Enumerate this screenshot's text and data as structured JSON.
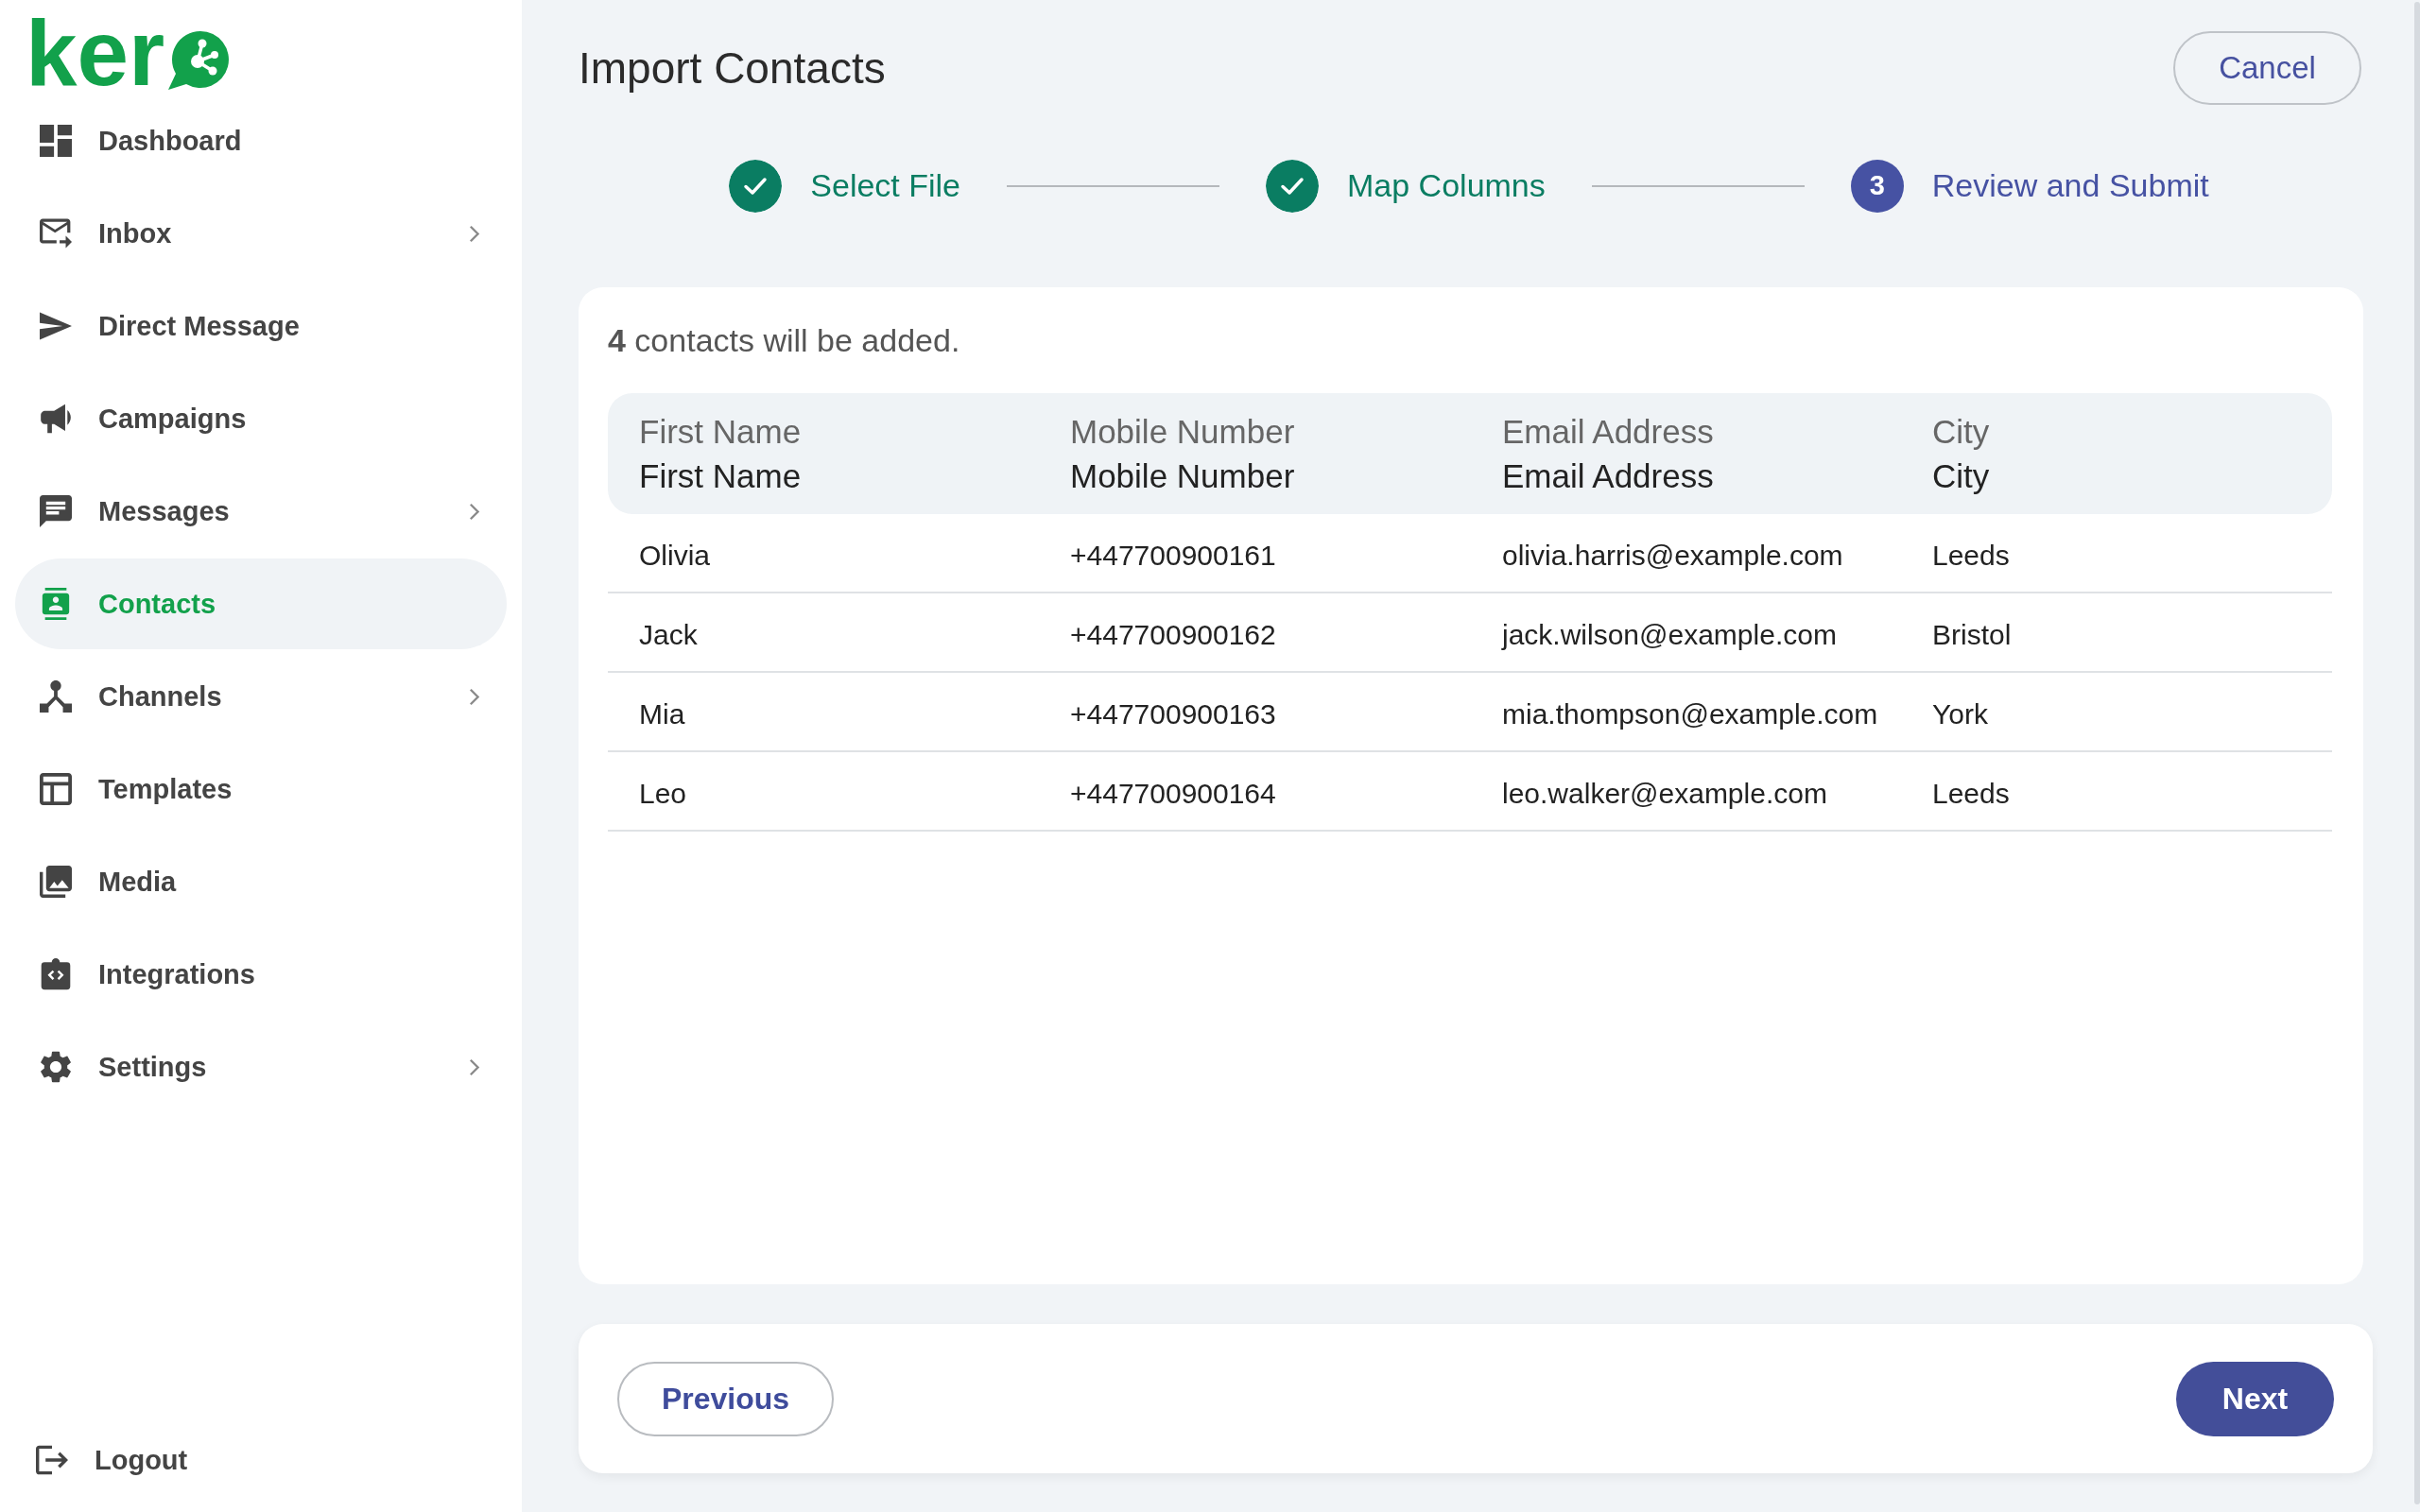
{
  "sidebar": {
    "logo": "ker",
    "items": [
      {
        "label": "Dashboard",
        "expandable": false,
        "selected": false
      },
      {
        "label": "Inbox",
        "expandable": true,
        "selected": false
      },
      {
        "label": "Direct Message",
        "expandable": false,
        "selected": false
      },
      {
        "label": "Campaigns",
        "expandable": false,
        "selected": false
      },
      {
        "label": "Messages",
        "expandable": true,
        "selected": false
      },
      {
        "label": "Contacts",
        "expandable": false,
        "selected": true
      },
      {
        "label": "Channels",
        "expandable": true,
        "selected": false
      },
      {
        "label": "Templates",
        "expandable": false,
        "selected": false
      },
      {
        "label": "Media",
        "expandable": false,
        "selected": false
      },
      {
        "label": "Integrations",
        "expandable": false,
        "selected": false
      },
      {
        "label": "Settings",
        "expandable": true,
        "selected": false
      }
    ],
    "logout": "Logout"
  },
  "header": {
    "title": "Import Contacts",
    "cancel_button": "Cancel"
  },
  "steps": [
    {
      "label": "Select File",
      "completed": true,
      "selected": false
    },
    {
      "label": "Map Columns",
      "completed": true,
      "selected": false
    },
    {
      "label": "Review and Submit",
      "completed": false,
      "selected": true,
      "number": "3"
    }
  ],
  "review": {
    "summary": "**4** contacts will be added.",
    "table": {
      "columns": [
        {
          "source": "First Name",
          "field": "First Name"
        },
        {
          "source": "Mobile Number",
          "field": "Mobile Number"
        },
        {
          "source": "Email Address",
          "field": "Email Address"
        },
        {
          "source": "City",
          "field": "City"
        }
      ],
      "rows": [
        [
          "Olivia",
          "+447700900161",
          "olivia.harris@example.com",
          "Leeds"
        ],
        [
          "Jack",
          "+447700900162",
          "jack.wilson@example.com",
          "Bristol"
        ],
        [
          "Mia",
          "+447700900163",
          "mia.thompson@example.com",
          "York"
        ],
        [
          "Leo",
          "+447700900164",
          "leo.walker@example.com",
          "Leeds"
        ]
      ]
    }
  },
  "footer": {
    "previous_button": "Previous",
    "next_button": "Next"
  }
}
